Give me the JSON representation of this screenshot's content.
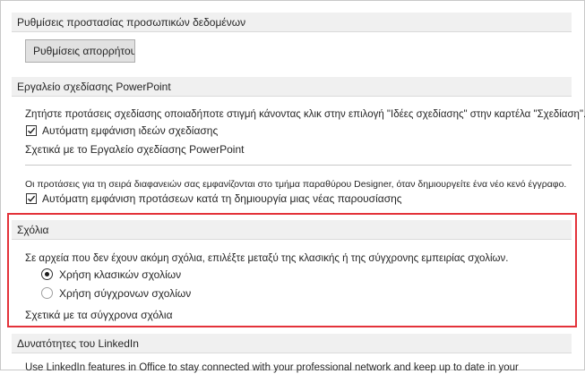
{
  "privacy": {
    "header": "Ρυθμίσεις προστασίας προσωπικών δεδομένων",
    "button_label": "Ρυθμίσεις απορρήτου..."
  },
  "designer": {
    "header": "Εργαλείο σχεδίασης PowerPoint",
    "description": "Ζητήστε προτάσεις σχεδίασης οποιαδήποτε στιγμή κάνοντας κλικ στην επιλογή \"Ιδέες σχεδίασης\" στην καρτέλα \"Σχεδίαση\".",
    "auto_ideas_label": "Αυτόματη εμφάνιση ιδεών σχεδίασης",
    "about_link": "Σχετικά με το Εργαλείο σχεδίασης PowerPoint",
    "first_slide_note": "Οι προτάσεις για τη σειρά διαφανειών σας εμφανίζονται στο τμήμα παραθύρου Designer, όταν δημιουργείτε ένα νέο κενό έγγραφο.",
    "auto_new_label": "Αυτόματη εμφάνιση προτάσεων κατά τη δημιουργία μιας νέας παρουσίασης"
  },
  "comments": {
    "header": "Σχόλια",
    "description": "Σε αρχεία που δεν έχουν ακόμη σχόλια, επιλέξτε μεταξύ της κλασικής ή της σύγχρονης εμπειρίας σχολίων.",
    "options": [
      {
        "label": "Χρήση κλασικών σχολίων",
        "selected": true
      },
      {
        "label": "Χρήση σύγχρονων σχολίων",
        "selected": false
      }
    ],
    "about_link": "Σχετικά με τα σύγχρονα σχόλια"
  },
  "linkedin": {
    "header": "Δυνατότητες του LinkedIn",
    "description": "Use LinkedIn features in Office to stay connected with your professional network and keep up to date in your"
  },
  "colors": {
    "highlight": "#e3323a",
    "header_bg": "#f0f0f0"
  }
}
